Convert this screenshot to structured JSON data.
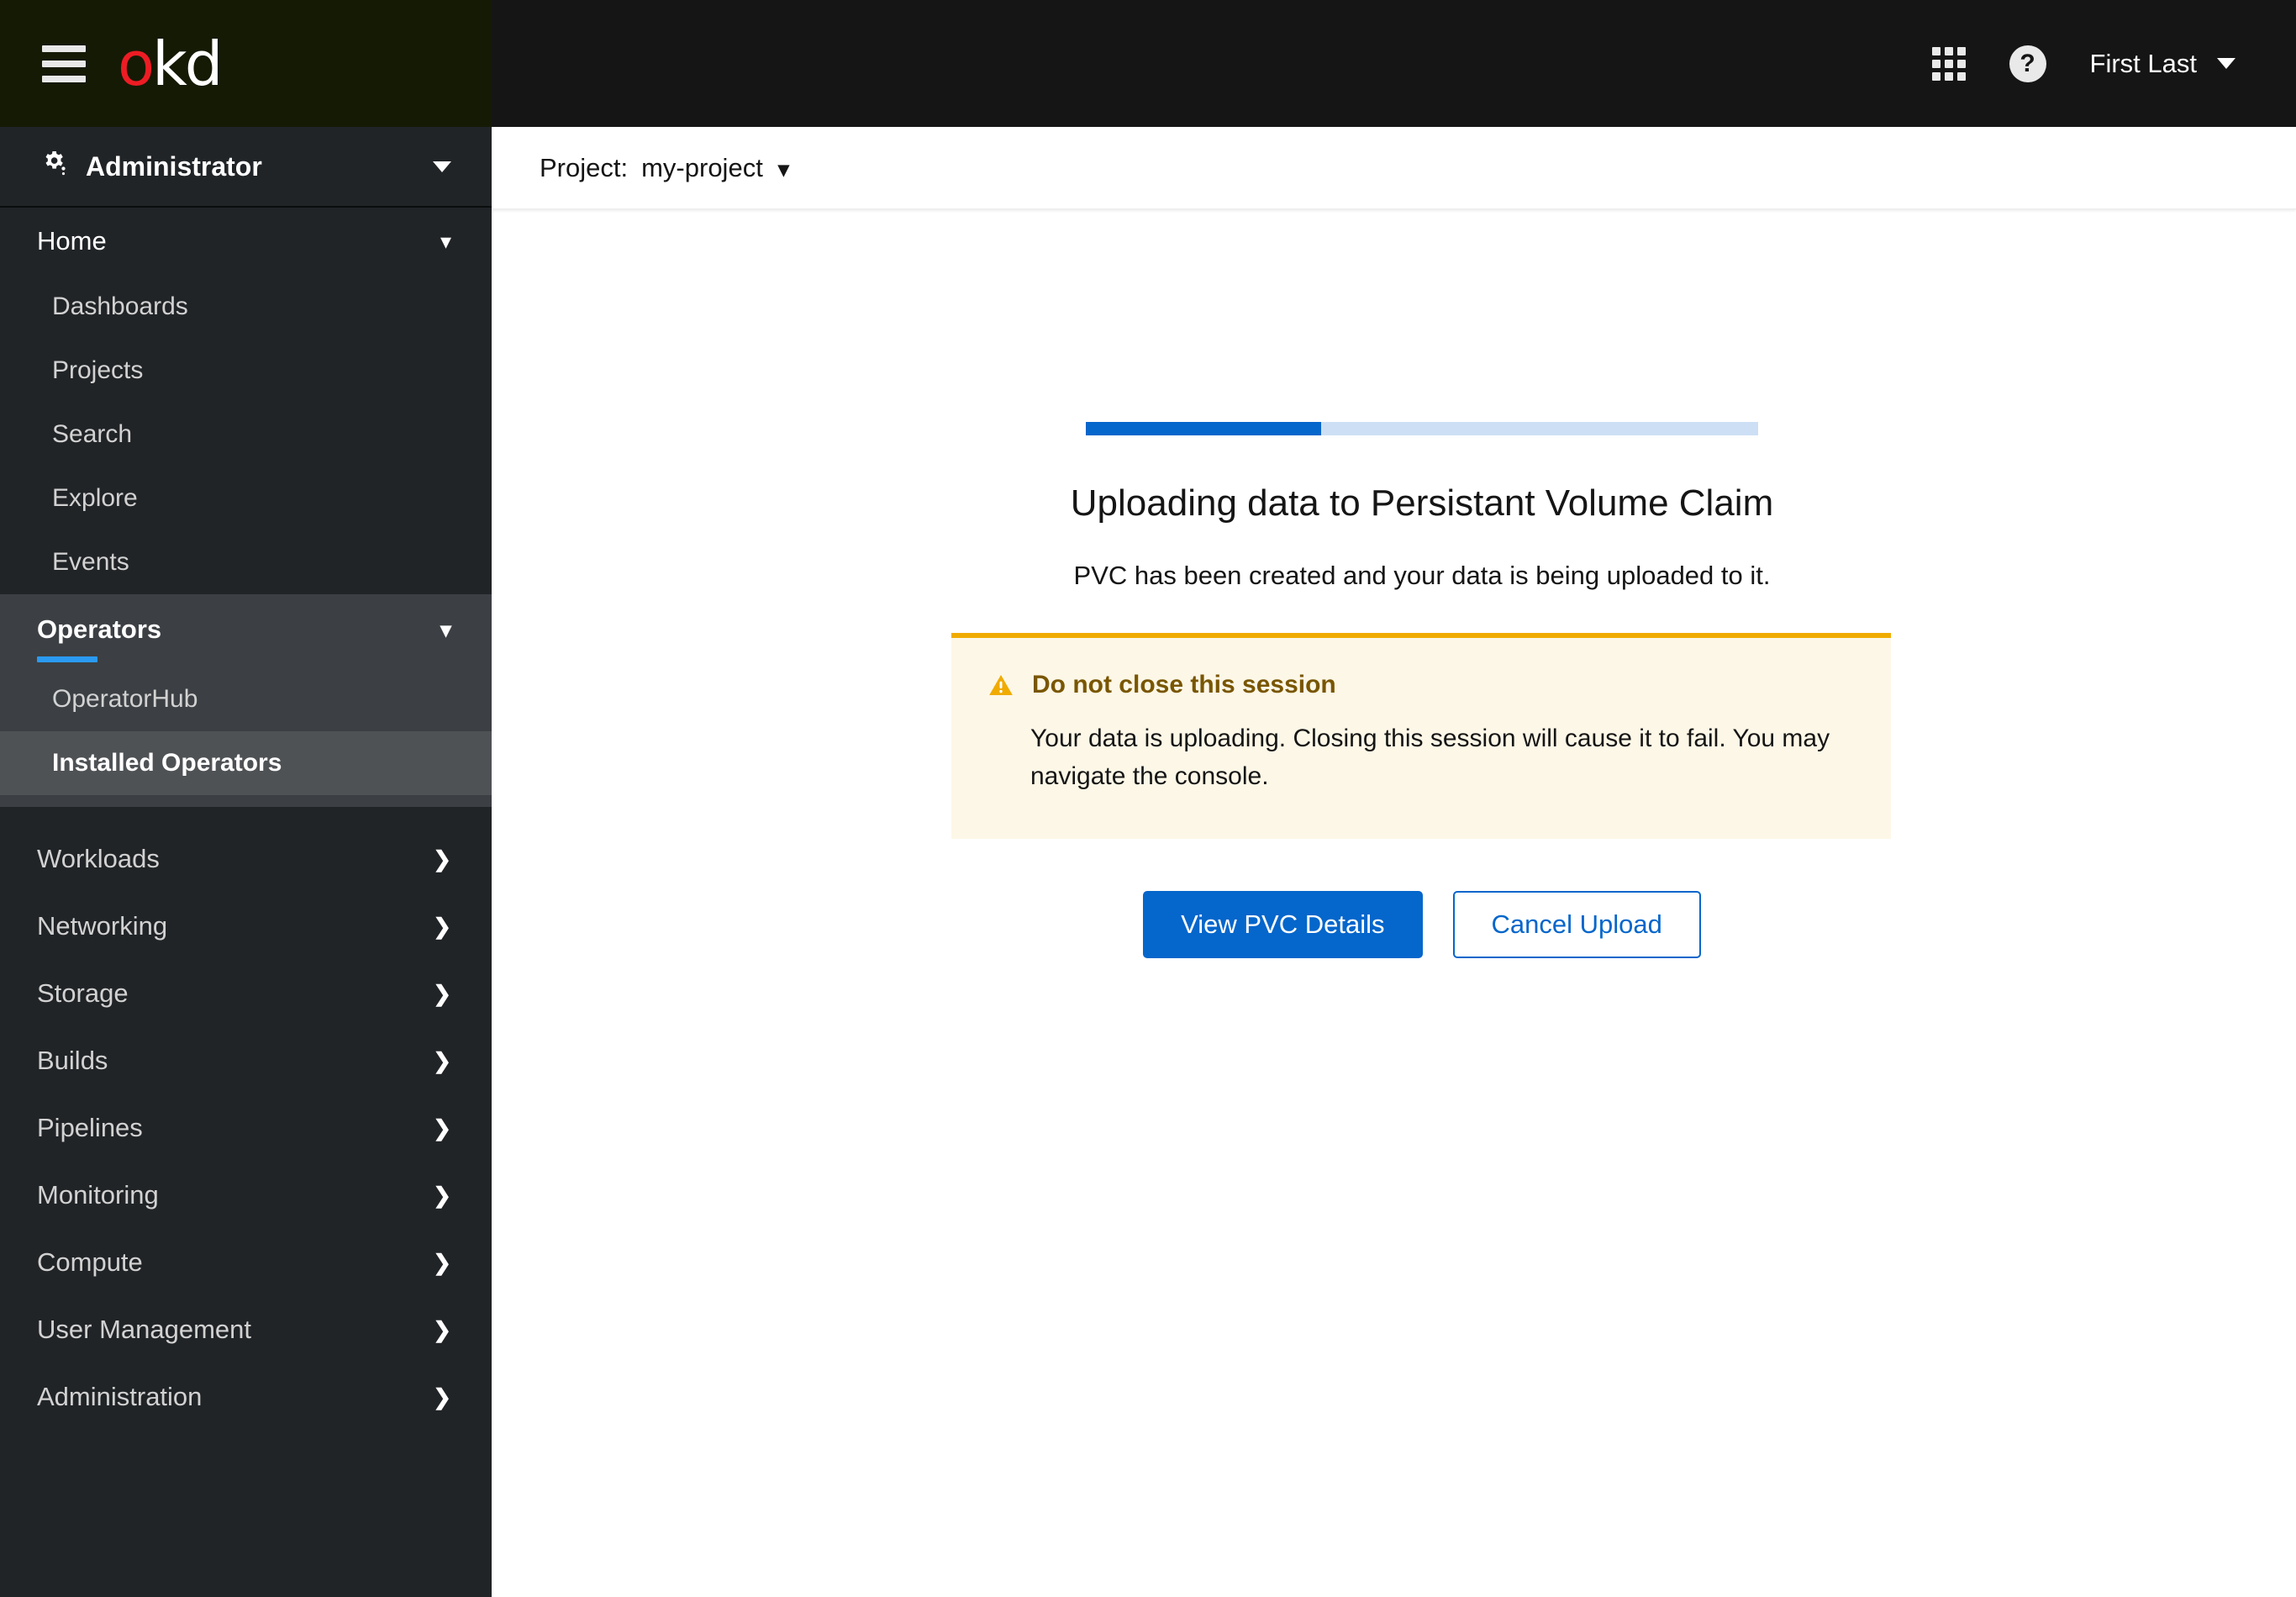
{
  "masthead": {
    "menu_toggle": "Toggle navigation",
    "logo_first": "o",
    "logo_rest": "kd",
    "apps_icon": "grid-apps-icon",
    "help_icon": "help-icon",
    "help_glyph": "?",
    "user_name": "First Last"
  },
  "sidebar": {
    "perspective": "Administrator",
    "groups": [
      {
        "label": "Home",
        "expanded": true,
        "chevron": "chevron-down",
        "items": [
          {
            "label": "Dashboards",
            "selected": false
          },
          {
            "label": "Projects",
            "selected": false
          },
          {
            "label": "Search",
            "selected": false
          },
          {
            "label": "Explore",
            "selected": false
          },
          {
            "label": "Events",
            "selected": false
          }
        ]
      },
      {
        "label": "Operators",
        "expanded": true,
        "active": true,
        "chevron": "chevron-down",
        "items": [
          {
            "label": "OperatorHub",
            "selected": false
          },
          {
            "label": "Installed Operators",
            "selected": true
          }
        ]
      },
      {
        "label": "Workloads",
        "expanded": false,
        "chevron": "chevron-right",
        "items": []
      },
      {
        "label": "Networking",
        "expanded": false,
        "chevron": "chevron-right",
        "items": []
      },
      {
        "label": "Storage",
        "expanded": false,
        "chevron": "chevron-right",
        "items": []
      },
      {
        "label": "Builds",
        "expanded": false,
        "chevron": "chevron-right",
        "items": []
      },
      {
        "label": "Pipelines",
        "expanded": false,
        "chevron": "chevron-right",
        "items": []
      },
      {
        "label": "Monitoring",
        "expanded": false,
        "chevron": "chevron-right",
        "items": []
      },
      {
        "label": "Compute",
        "expanded": false,
        "chevron": "chevron-right",
        "items": []
      },
      {
        "label": "User Management",
        "expanded": false,
        "chevron": "chevron-right",
        "items": []
      },
      {
        "label": "Administration",
        "expanded": false,
        "chevron": "chevron-right",
        "items": []
      }
    ]
  },
  "project_bar": {
    "label": "Project:",
    "value": "my-project",
    "caret": "⌄"
  },
  "upload": {
    "progress_percent": 35,
    "title": "Uploading data to Persistant Volume Claim",
    "subtitle": "PVC has been created and your data is being uploaded to it.",
    "alert": {
      "icon": "warning-triangle-icon",
      "title": "Do not close this session",
      "body": "Your data is uploading. Closing this session will cause it to fail. You may navigate the console."
    },
    "primary_button": "View PVC Details",
    "secondary_button": "Cancel Upload"
  },
  "colors": {
    "accent_blue": "#0566cb",
    "progress_track": "#cddff5",
    "warning_gold": "#f0ab00",
    "alert_bg": "#fdf7e7",
    "alert_title": "#795600",
    "sidebar_bg": "#212427",
    "masthead_bg": "#151a05",
    "logo_red": "#ed1c24",
    "active_underline": "#2b9af3",
    "selected_item_bg": "#4f5255"
  }
}
